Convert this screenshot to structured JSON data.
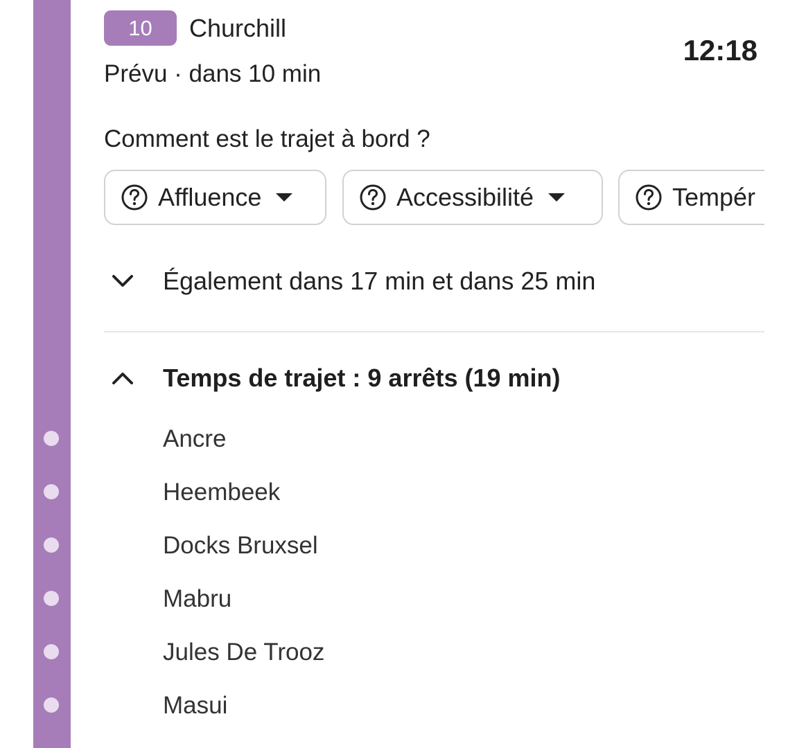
{
  "theme": {
    "line_color": "#a67db8",
    "dot_color": "#e9dcef"
  },
  "departure": {
    "line_number": "10",
    "destination": "Churchill",
    "time": "12:18",
    "status": "Prévu · dans 10 min"
  },
  "feedback": {
    "question": "Comment est le trajet à bord ?",
    "chips": [
      {
        "label": "Affluence",
        "icon": "question-circle-icon"
      },
      {
        "label": "Accessibilité",
        "icon": "question-circle-icon"
      },
      {
        "label": "Tempér",
        "icon": "question-circle-icon"
      }
    ]
  },
  "also": {
    "label": "Également dans 17 min et dans 25 min",
    "icon": "chevron-down-icon"
  },
  "journey": {
    "label": "Temps de trajet : 9 arrêts (19 min)",
    "icon": "chevron-up-icon",
    "stops": [
      "Ancre",
      "Heembeek",
      "Docks Bruxsel",
      "Mabru",
      "Jules De Trooz",
      "Masui"
    ]
  }
}
